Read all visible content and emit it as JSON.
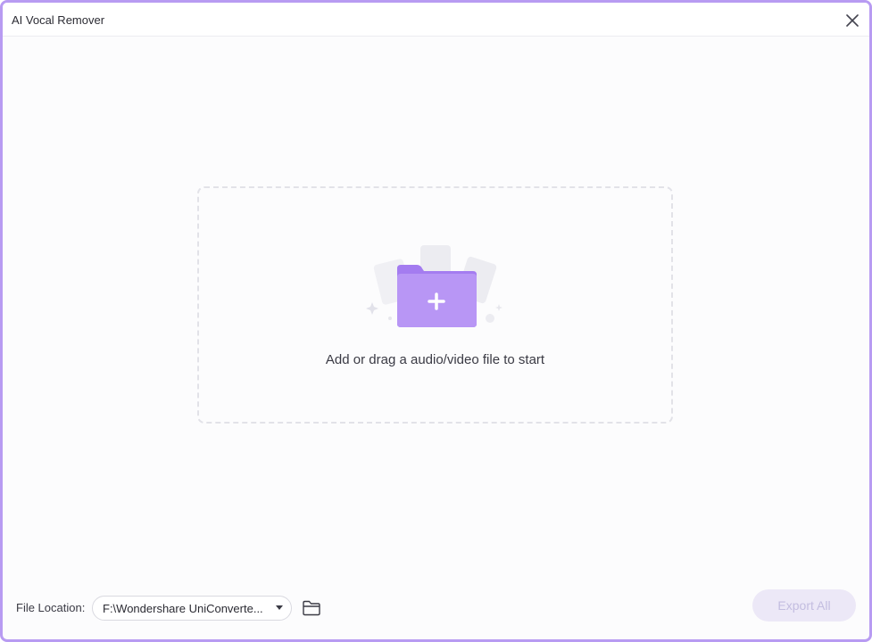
{
  "window": {
    "title": "AI Vocal Remover",
    "accent_color": "#b89bf2"
  },
  "titlebar": {
    "close_icon": "close-icon"
  },
  "dropzone": {
    "instruction": "Add or drag a audio/video file to start",
    "icon": "folder-add-icon",
    "icon_color": "#a47cf0"
  },
  "footer": {
    "file_location_label": "File Location:",
    "file_location_value": "F:\\Wondershare UniConverte...",
    "dropdown_icon": "chevron-down-icon",
    "folder_icon": "folder-open-icon",
    "export_label": "Export All",
    "export_enabled": false
  }
}
